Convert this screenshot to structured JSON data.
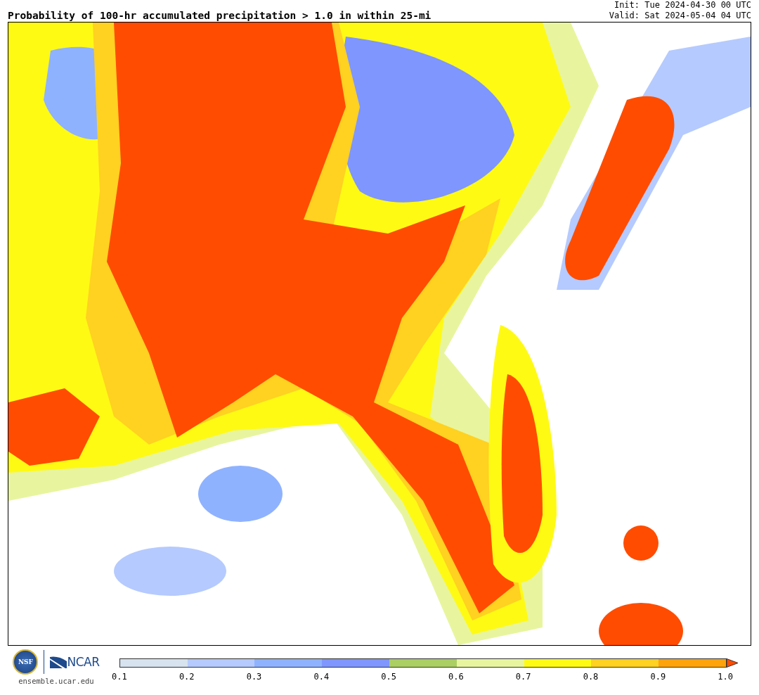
{
  "title": "Probability of 100-hr accumulated precipitation > 1.0 in within 25-mi",
  "init": "Init: Tue 2024-04-30 00 UTC",
  "valid": "Valid: Sat 2024-05-04 04 UTC",
  "logos": {
    "nsf": "NSF",
    "ncar": "NCAR",
    "url": "ensemble.ucar.edu"
  },
  "legend": {
    "bins": [
      {
        "color": "#d7e3ee"
      },
      {
        "color": "#b5cafe"
      },
      {
        "color": "#8fb2ff"
      },
      {
        "color": "#7f96ff"
      },
      {
        "color": "#abcf63"
      },
      {
        "color": "#e8f59e"
      },
      {
        "color": "#fffa14"
      },
      {
        "color": "#ffd121"
      },
      {
        "color": "#ffa30a"
      },
      {
        "color": "#ff4c00",
        "kind": "extend"
      }
    ],
    "ticks": [
      "0.1",
      "0.2",
      "0.3",
      "0.4",
      "0.5",
      "0.6",
      "0.7",
      "0.8",
      "0.9",
      "1.0"
    ]
  }
}
